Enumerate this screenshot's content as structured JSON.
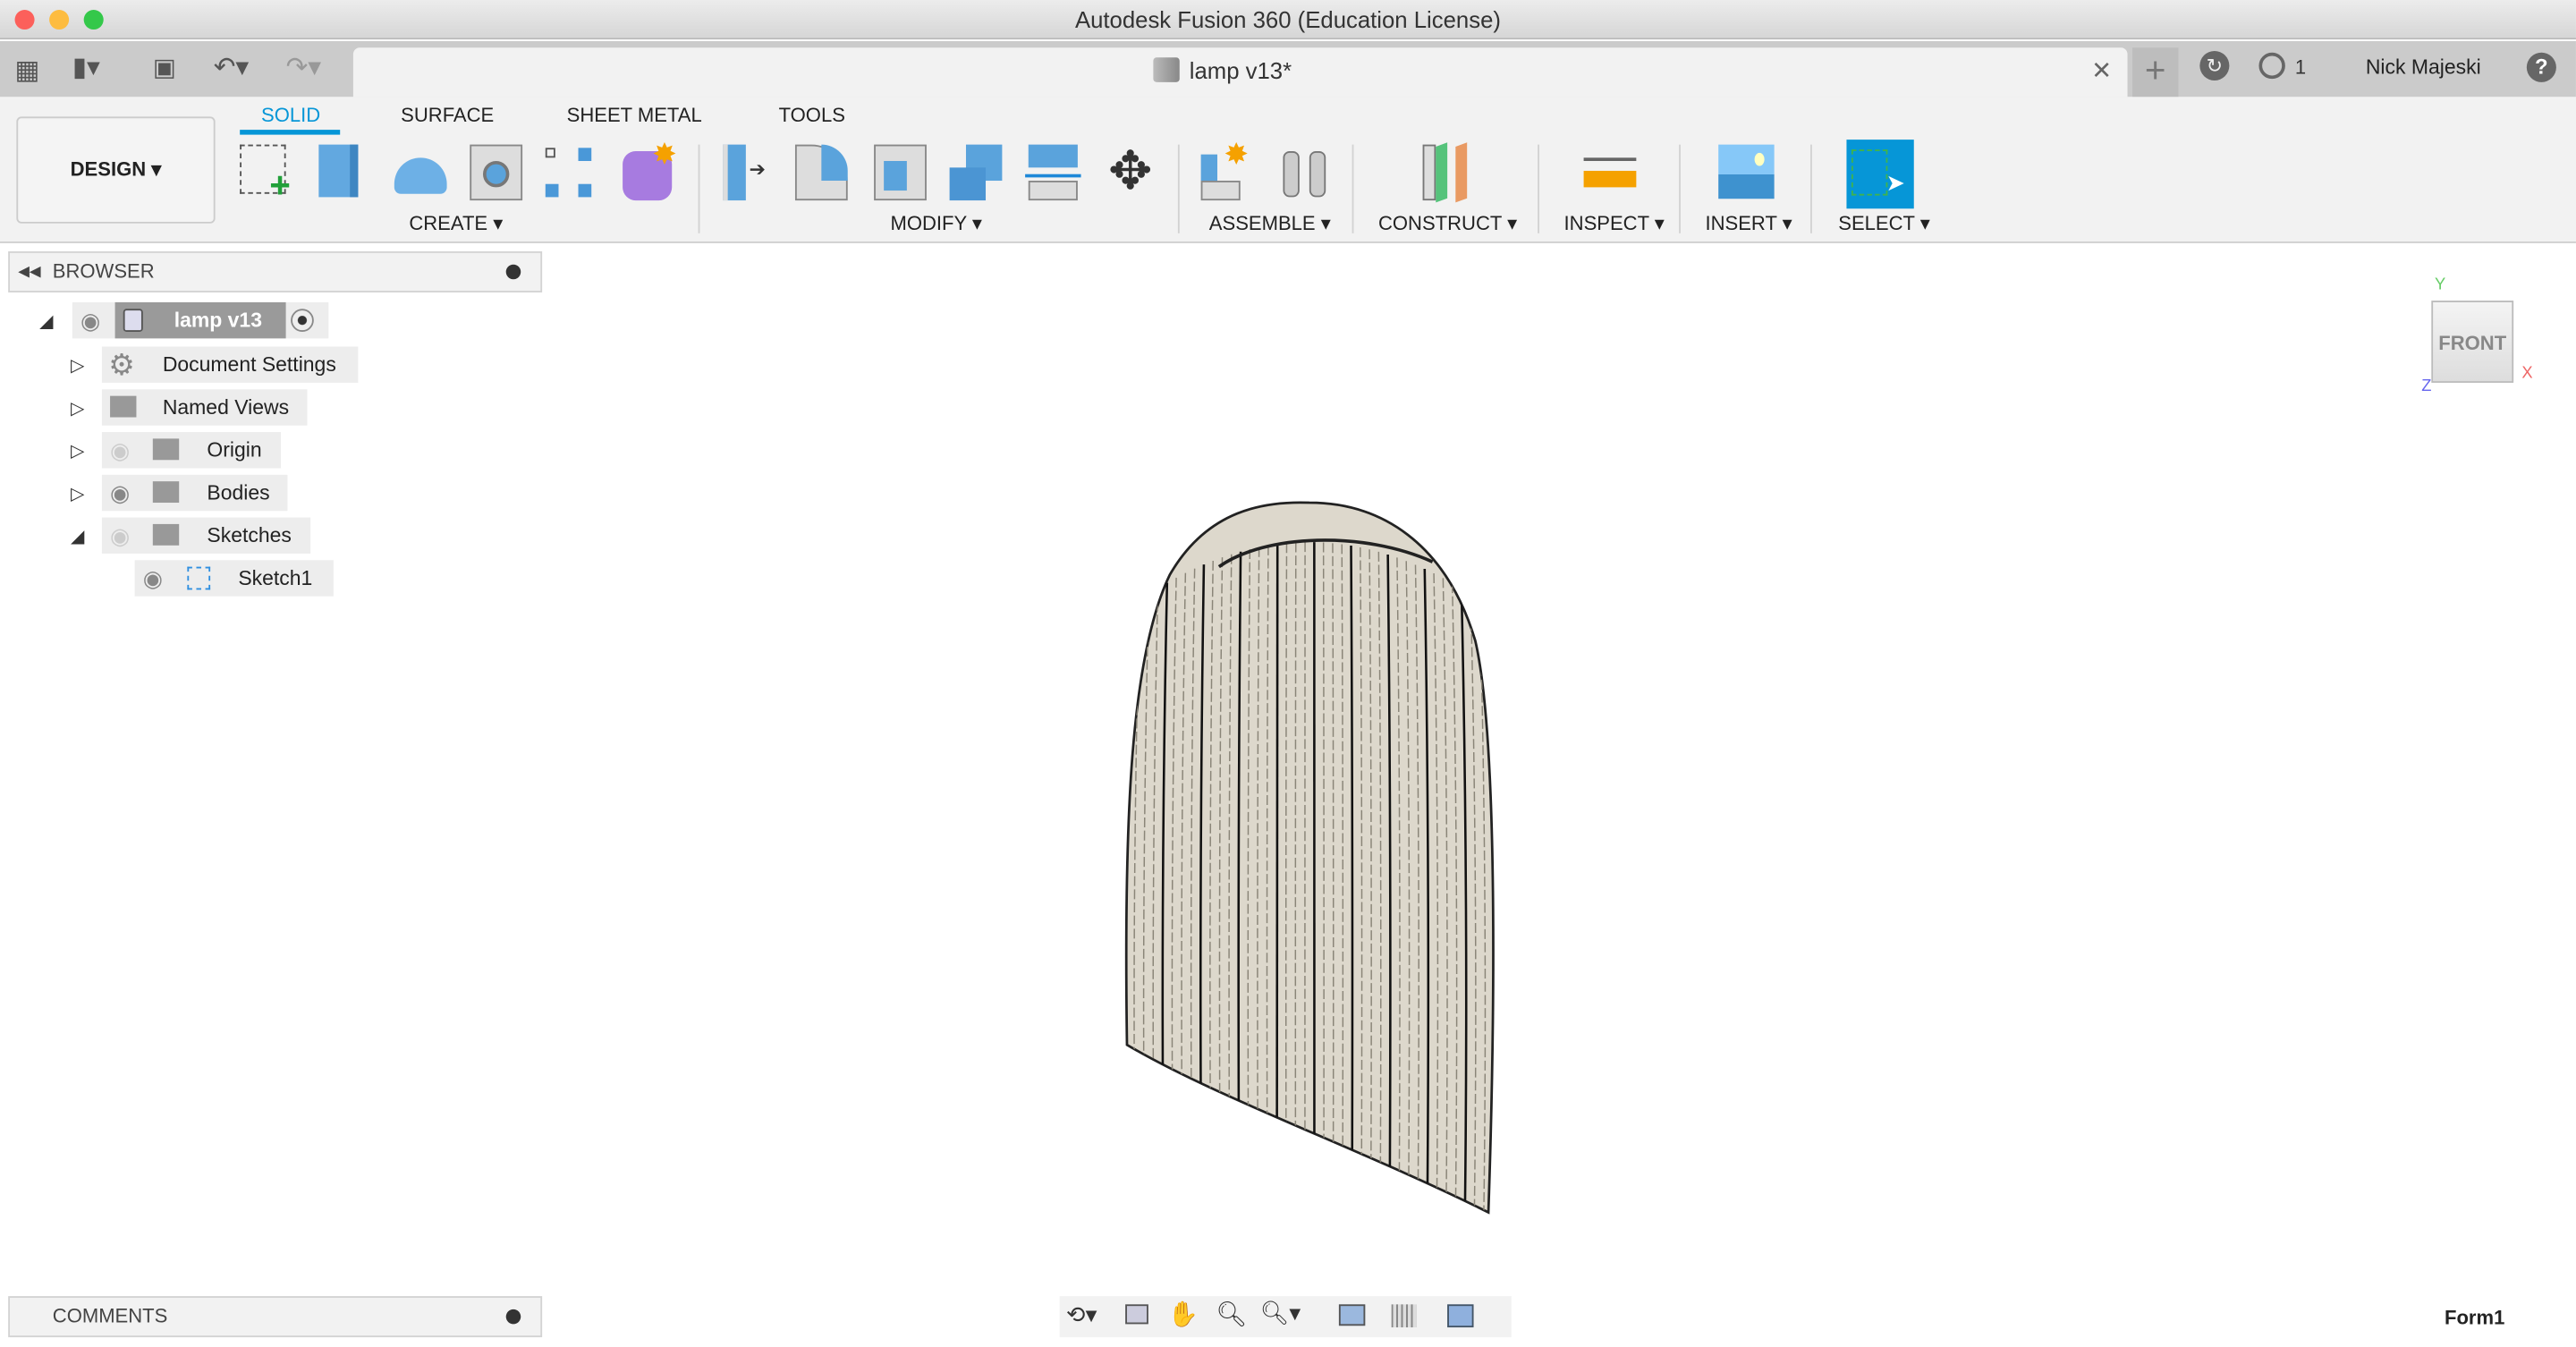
{
  "window": {
    "title": "Autodesk Fusion 360 (Education License)"
  },
  "document_tab": {
    "title": "lamp v13*",
    "close_icon": "close-icon"
  },
  "topbar": {
    "user": "Nick Majeski",
    "jobs_count": "1"
  },
  "workspace": {
    "label": "DESIGN"
  },
  "ribbon": {
    "tabs": [
      {
        "label": "SOLID",
        "active": true
      },
      {
        "label": "SURFACE"
      },
      {
        "label": "SHEET METAL"
      },
      {
        "label": "TOOLS"
      }
    ],
    "groups": [
      "CREATE",
      "MODIFY",
      "ASSEMBLE",
      "CONSTRUCT",
      "INSPECT",
      "INSERT",
      "SELECT"
    ],
    "accent": "#0696d7"
  },
  "browser": {
    "title": "BROWSER",
    "root": "lamp v13",
    "items": [
      "Document Settings",
      "Named Views",
      "Origin",
      "Bodies",
      "Sketches",
      "Sketch1"
    ]
  },
  "comments": {
    "title": "COMMENTS"
  },
  "viewcube": {
    "face": "FRONT",
    "axes": [
      "Y",
      "X",
      "Z"
    ]
  },
  "status": {
    "label": "Form1"
  }
}
